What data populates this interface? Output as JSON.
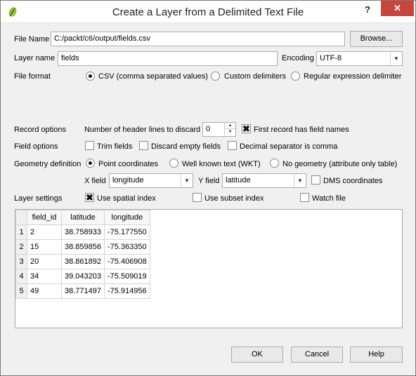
{
  "window": {
    "title": "Create a Layer from a Delimited Text File",
    "help_glyph": "?",
    "close_glyph": "✕"
  },
  "file": {
    "label": "File Name",
    "value": "C:/packt/c6/output/fields.csv",
    "browse_label": "Browse..."
  },
  "layer": {
    "label": "Layer name",
    "value": "fields",
    "encoding_label": "Encoding",
    "encoding_value": "UTF-8"
  },
  "file_format": {
    "label": "File format",
    "options": [
      {
        "label": "CSV (comma separated values)",
        "selected": true
      },
      {
        "label": "Custom delimiters",
        "selected": false
      },
      {
        "label": "Regular expression delimiter",
        "selected": false
      }
    ]
  },
  "record_options": {
    "label": "Record options",
    "header_lines_label": "Number of header lines to discard",
    "header_lines_value": "0",
    "first_record_label": "First record has field names",
    "first_record_checked": true
  },
  "field_options": {
    "label": "Field options",
    "trim_label": "Trim fields",
    "discard_label": "Discard empty fields",
    "decimal_label": "Decimal separator is comma"
  },
  "geometry": {
    "label": "Geometry definition",
    "options": [
      {
        "label": "Point coordinates",
        "selected": true
      },
      {
        "label": "Well known text (WKT)",
        "selected": false
      },
      {
        "label": "No geometry (attribute only table)",
        "selected": false
      }
    ],
    "x_field_label": "X field",
    "x_field_value": "longitude",
    "y_field_label": "Y field",
    "y_field_value": "latitude",
    "dms_label": "DMS coordinates"
  },
  "layer_settings": {
    "label": "Layer settings",
    "spatial_index_label": "Use spatial index",
    "spatial_index_checked": true,
    "subset_index_label": "Use subset index",
    "watch_file_label": "Watch file"
  },
  "preview": {
    "columns": [
      "field_id",
      "latitude",
      "longitude"
    ],
    "rows": [
      {
        "n": "1",
        "cells": [
          "2",
          "38.758933",
          "-75.177550"
        ]
      },
      {
        "n": "2",
        "cells": [
          "15",
          "38.859856",
          "-75.363350"
        ]
      },
      {
        "n": "3",
        "cells": [
          "20",
          "38.861892",
          "-75.406908"
        ]
      },
      {
        "n": "4",
        "cells": [
          "34",
          "39.043203",
          "-75.509019"
        ]
      },
      {
        "n": "5",
        "cells": [
          "49",
          "38.771497",
          "-75.914956"
        ]
      }
    ]
  },
  "buttons": {
    "ok": "OK",
    "cancel": "Cancel",
    "help": "Help"
  },
  "icons": {
    "app": "qgis-leaf-icon",
    "checkmark": "✖",
    "dropdown": "▼",
    "spin_up": "▲",
    "spin_down": "▼"
  }
}
